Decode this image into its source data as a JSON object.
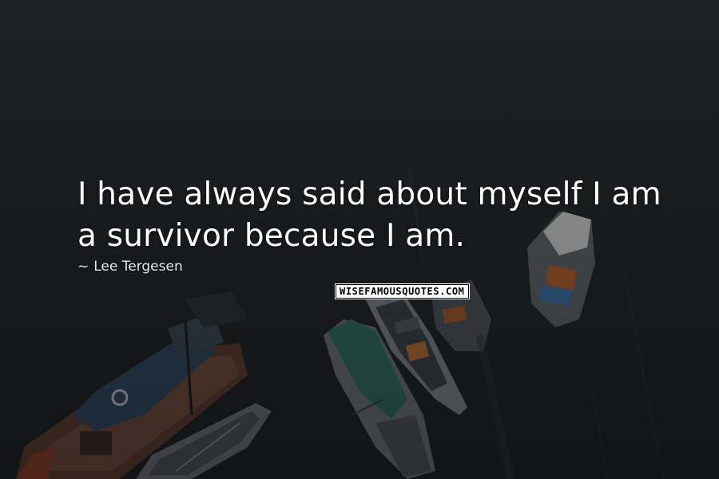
{
  "quote": {
    "text": "I have always said about myself I am a survivor because I am.",
    "author_prefix": "~",
    "author": "Lee Tergesen"
  },
  "watermark": {
    "text": "WISEFAMOUSQUOTES.COM"
  },
  "colors": {
    "background": "#1e2124",
    "text": "#ffffff",
    "watermark_bg": "#ffffff",
    "watermark_text": "#000000"
  },
  "scene": {
    "description_icons": [
      "boat-shape",
      "boat-shape",
      "boat-shape",
      "boat-shape",
      "boat-shape"
    ]
  }
}
